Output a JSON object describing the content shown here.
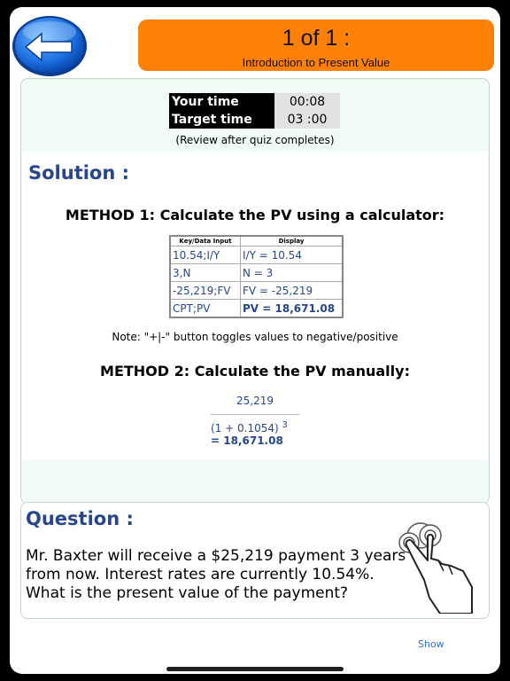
{
  "header": {
    "counter": "1 of 1 :",
    "subtitle": "Introduction to Present Value"
  },
  "timer": {
    "your_time_label": "Your time",
    "your_time_value": "00:08",
    "target_time_label": "Target time",
    "target_time_value": "03 :00",
    "review_note": "(Review after quiz completes)"
  },
  "solution": {
    "heading": "Solution :",
    "method1_heading": "METHOD 1: Calculate the PV using a calculator:",
    "table": {
      "headers": [
        "Key/Data Input",
        "Display"
      ],
      "rows": [
        [
          "10.54;I/Y",
          "I/Y = 10.54"
        ],
        [
          "3,N",
          "N = 3"
        ],
        [
          "-25,219;FV",
          "FV = -25,219"
        ],
        [
          "CPT;PV",
          "PV = 18,671.08"
        ]
      ]
    },
    "note": "Note: \"+|-\" button toggles values to negative/positive",
    "method2_heading": "METHOD 2: Calculate the PV manually:",
    "numerator": "25,219",
    "denominator": "(1 + 0.1054)",
    "exponent": "3",
    "result": "= 18,671.08"
  },
  "question": {
    "heading": "Question :",
    "text": "Mr. Baxter will receive a $25,219 payment 3 years from now. Interest rates are currently 10.54%. What is the present value of the payment?"
  },
  "footer": {
    "show_label": "Show"
  },
  "icons": {
    "back": "back-arrow-icon",
    "gesture": "hand-tap-icon"
  },
  "colors": {
    "header_bg": "#fd8007",
    "heading": "#27478a",
    "link": "#2a72e0",
    "divider": "#e85a5a"
  }
}
